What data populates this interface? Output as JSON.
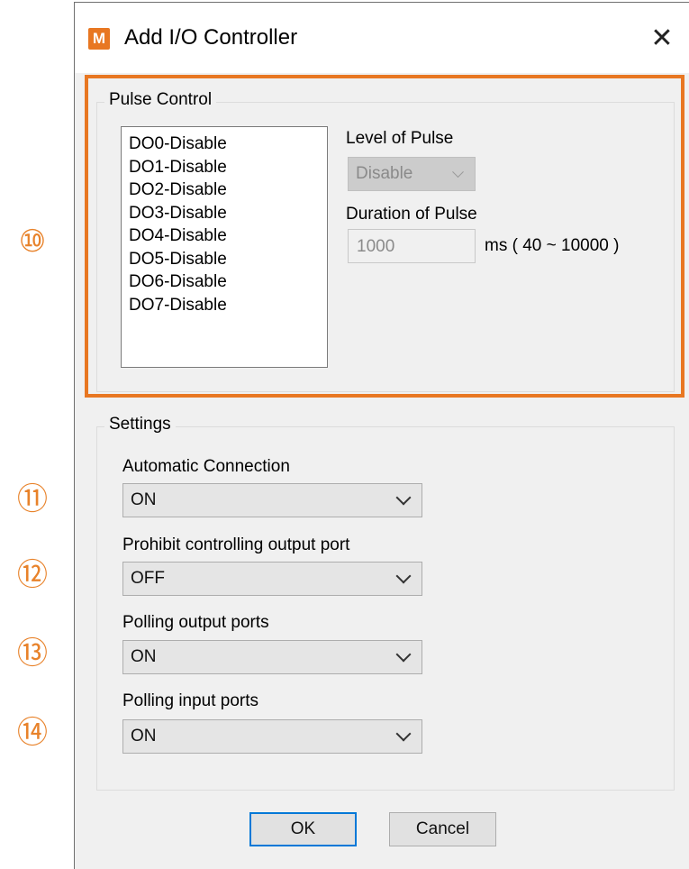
{
  "callouts": [
    "⑩",
    "⑪",
    "⑫",
    "⑬",
    "⑭"
  ],
  "window": {
    "title": "Add I/O Controller",
    "icon_letter": "M",
    "close_glyph": "✕"
  },
  "pulse_control": {
    "legend": "Pulse Control",
    "items": [
      "DO0-Disable",
      "DO1-Disable",
      "DO2-Disable",
      "DO3-Disable",
      "DO4-Disable",
      "DO5-Disable",
      "DO6-Disable",
      "DO7-Disable"
    ],
    "level_label": "Level of Pulse",
    "level_value": "Disable",
    "duration_label": "Duration of Pulse",
    "duration_value": "1000",
    "duration_unit": "ms ( 40 ~ 10000 )"
  },
  "settings": {
    "legend": "Settings",
    "automatic_connection": {
      "label": "Automatic Connection",
      "value": "ON"
    },
    "prohibit_output": {
      "label": "Prohibit controlling output port",
      "value": "OFF"
    },
    "polling_output": {
      "label": "Polling output ports",
      "value": "ON"
    },
    "polling_input": {
      "label": "Polling input ports",
      "value": "ON"
    }
  },
  "buttons": {
    "ok": "OK",
    "cancel": "Cancel"
  },
  "colors": {
    "highlight": "#e87722",
    "callout": "#e8822a",
    "default_button_border": "#0078d7"
  }
}
